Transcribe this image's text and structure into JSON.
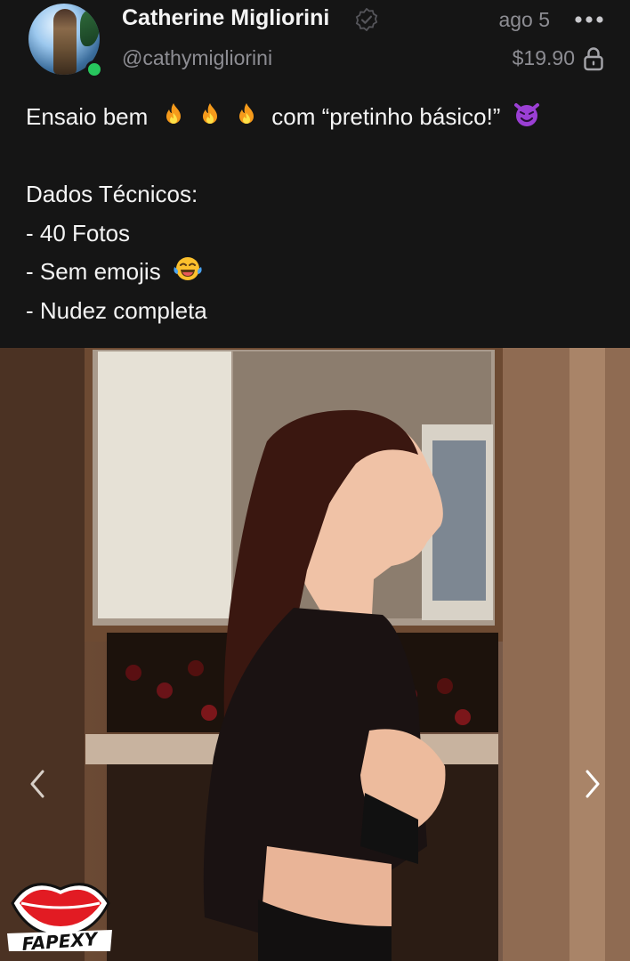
{
  "author": {
    "name": "Catherine Migliorini",
    "handle": "@cathymigliorini",
    "online": true,
    "avatar_icon": "profile-photo"
  },
  "post": {
    "date": "ago 5",
    "price": "$19.90",
    "locked": true,
    "lines": [
      {
        "text": "Ensaio bem",
        "emojis": [
          "fire",
          "fire",
          "fire"
        ],
        "text_after": "com “pretinho básico!”",
        "emoji_after": "smiling-imp"
      },
      {
        "text": ""
      },
      {
        "text": "Dados Técnicos:"
      },
      {
        "text": "- 40 Fotos"
      },
      {
        "text": "- Sem emojis",
        "emoji_after": "face-with-tears-of-joy"
      },
      {
        "text": "- Nudez completa"
      }
    ]
  },
  "media": {
    "description_icon": "photo",
    "watermark_text": "FAPEXY"
  },
  "colors": {
    "background": "#151515",
    "text_primary": "#f4f4f4",
    "text_secondary": "#8d8d93",
    "online": "#27c65d"
  }
}
